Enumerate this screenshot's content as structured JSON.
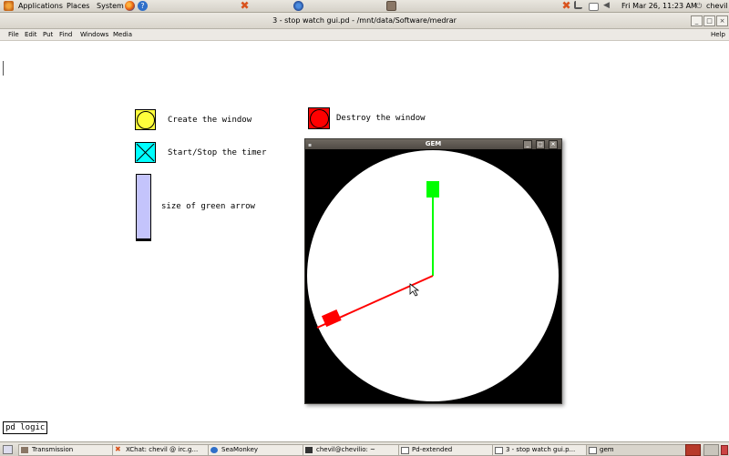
{
  "top_panel": {
    "menus": [
      "Applications",
      "Places",
      "System"
    ],
    "clock": "Fri Mar 26, 11:23 AM",
    "user": "chevil",
    "icons": [
      "gnome-foot-icon",
      "firefox-icon",
      "help-icon",
      "xchat-icon",
      "seamonkey-icon",
      "transmission-icon",
      "network-icon",
      "mail-icon",
      "battery-icon",
      "volume-icon",
      "power-icon"
    ]
  },
  "pd_window": {
    "title": "3 - stop watch gui.pd  - /mnt/data/Software/medrar",
    "buttons": [
      "_",
      "□",
      "×"
    ],
    "menus": [
      "File",
      "Edit",
      "Put",
      "Find",
      "Windows",
      "Media"
    ],
    "help": "Help"
  },
  "patch": {
    "create_label": "Create the window",
    "startstop_label": "Start/Stop the timer",
    "slider_label": "size of green arrow",
    "destroy_label": "Destroy the window",
    "subpatch": "pd logic",
    "colors": {
      "create_bang": "#ffff3c",
      "toggle": "#00ffff",
      "slider": "#c4c4fc",
      "destroy_bang": "#ff0000"
    }
  },
  "gem_window": {
    "title": "GEM",
    "buttons": [
      "_",
      "□",
      "×"
    ],
    "colors": {
      "background": "#000000",
      "dial": "#ffffff",
      "green_hand": "#00ff00",
      "red_hand": "#ff0000"
    }
  },
  "taskbar": {
    "tasks": [
      {
        "label": "Transmission",
        "icon": "transmission-icon"
      },
      {
        "label": "XChat: chevil @ irc.g...",
        "icon": "xchat-icon"
      },
      {
        "label": "SeaMonkey",
        "icon": "seamonkey-icon"
      },
      {
        "label": "chevil@chevilio: ~",
        "icon": "terminal-icon"
      },
      {
        "label": "Pd-extended",
        "icon": "window-icon"
      },
      {
        "label": "3 - stop watch gui.p...",
        "icon": "window-icon"
      },
      {
        "label": "gem",
        "icon": "window-icon"
      }
    ]
  }
}
